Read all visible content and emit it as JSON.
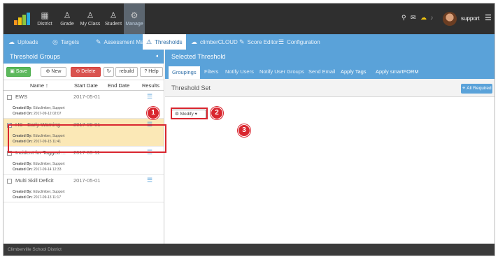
{
  "topnav": {
    "items": [
      {
        "label": "District",
        "icon": "building-icon"
      },
      {
        "label": "Grade",
        "icon": "users-icon"
      },
      {
        "label": "My Class",
        "icon": "users-icon"
      },
      {
        "label": "Student",
        "icon": "user-icon"
      },
      {
        "label": "Manage",
        "icon": "gear-icon"
      }
    ],
    "user": "support"
  },
  "tabs": [
    "Uploads",
    "Targets",
    "Assessment Manager",
    "Thresholds",
    "climberCLOUD",
    "Score Editor",
    "Configuration"
  ],
  "left": {
    "title": "Threshold Groups",
    "collapse_icon": "◂",
    "buttons": {
      "save": "Save",
      "new": "New",
      "delete": "Delete",
      "rebuild": "rebuild",
      "help": "Help"
    },
    "columns": {
      "name": "Name ↑",
      "start": "Start Date",
      "end": "End Date",
      "results": "Results"
    },
    "rows": [
      {
        "name": "EWS",
        "start": "2017-05-01",
        "end": "",
        "by_label": "Created By:",
        "by": "Educlimber, Support",
        "on_label": "Created On:",
        "on": "2017-09-12 02:07",
        "checked": ""
      },
      {
        "name": "HS - Early Warning",
        "start": "2017-09-01",
        "end": "",
        "by_label": "Created By:",
        "by": "Educlimber, Support",
        "on_label": "Created On:",
        "on": "2017-09-15 11:41",
        "checked": "✓"
      },
      {
        "name": "Incident for Tagged ...",
        "start": "2017-09-11",
        "end": "",
        "by_label": "Created By:",
        "by": "Educlimber, Support",
        "on_label": "Created On:",
        "on": "2017-09-14 12:33",
        "checked": ""
      },
      {
        "name": "Multi Skill Deficit",
        "start": "2017-05-01",
        "end": "",
        "by_label": "Created By:",
        "by": "Educlimber, Support",
        "on_label": "Created On:",
        "on": "2017-09-13 11:17",
        "checked": ""
      }
    ]
  },
  "right": {
    "title": "Selected Threshold",
    "tabs": [
      "Groupings",
      "Filters",
      "Notify Users",
      "Notify User Groups",
      "Send Email",
      "Apply Tags",
      "Apply smartFORM"
    ],
    "section_title": "Threshold Set",
    "all_required": "All Required",
    "modify_label": "Modify"
  },
  "annotations": [
    "1",
    "2",
    "3"
  ],
  "footer": "Climberville School District",
  "colors": {
    "accent": "#5aa2d9",
    "topbar": "#2f2f2f",
    "highlight": "#d9262f",
    "selected_row": "#fbe8b6"
  }
}
